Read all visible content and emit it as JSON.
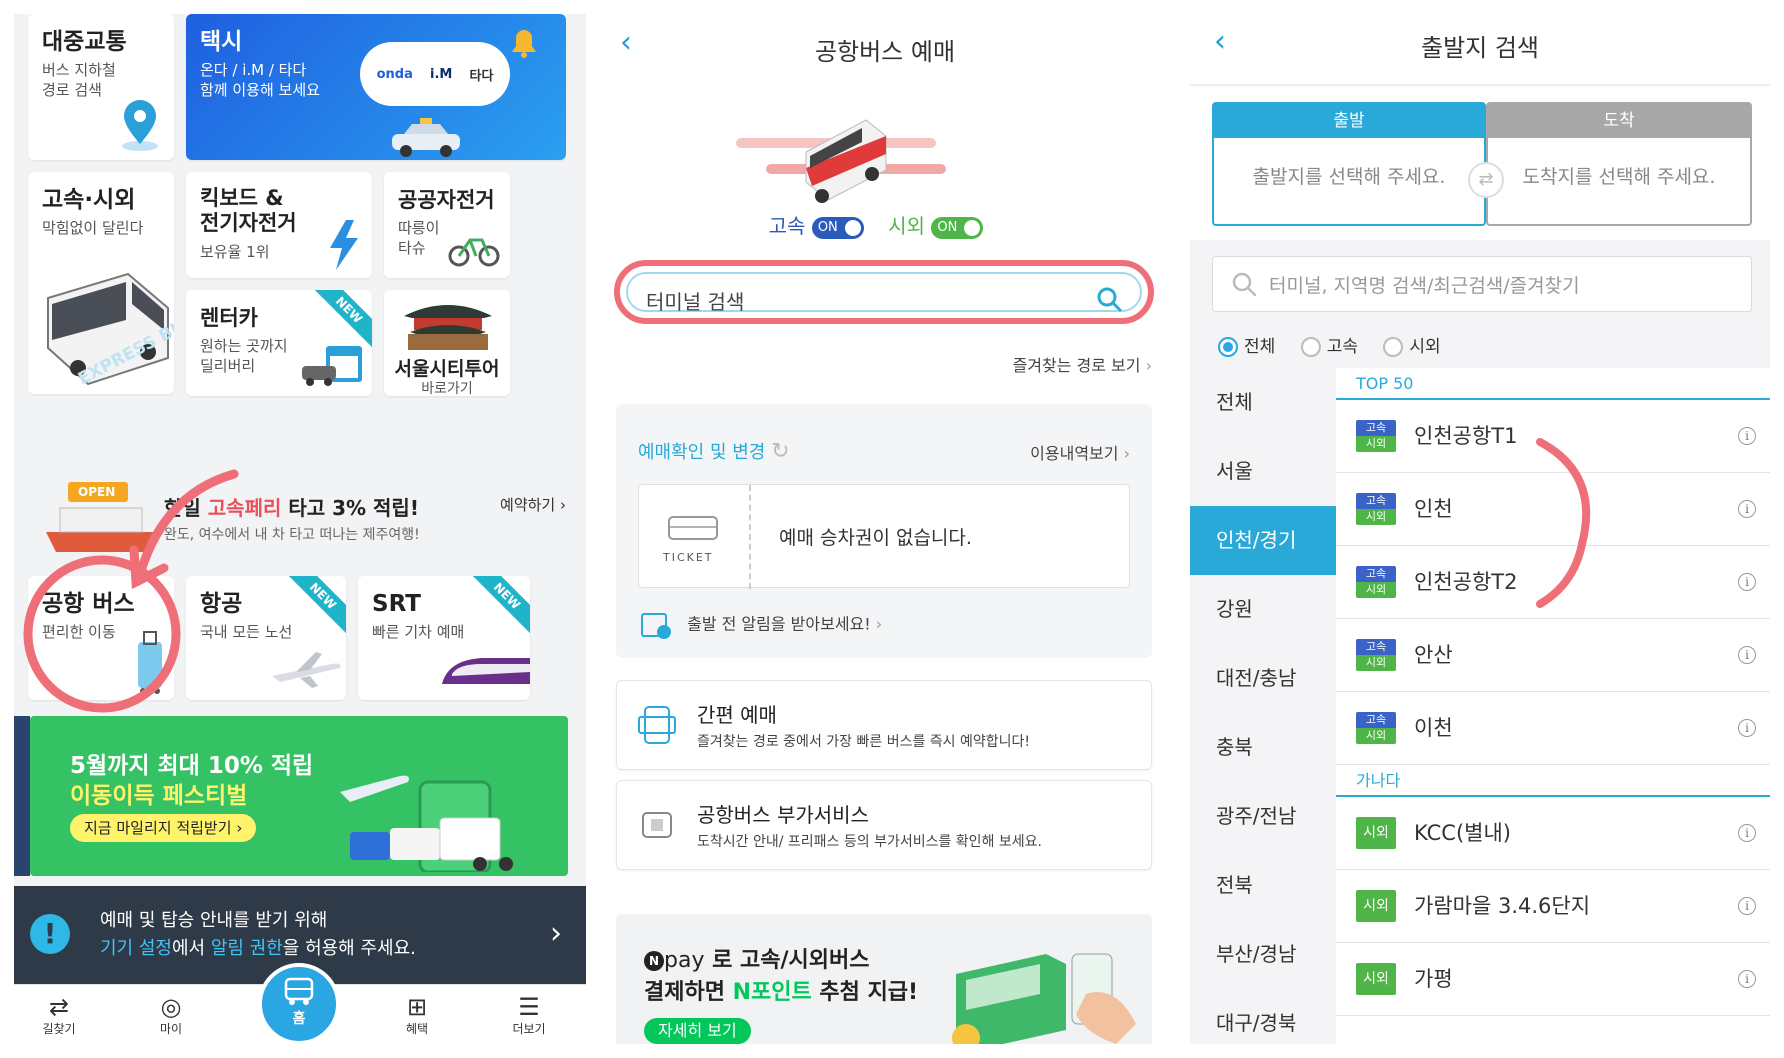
{
  "screen1": {
    "transit": {
      "title": "대중교통",
      "sub": "버스 지하철\n경로 검색"
    },
    "taxi": {
      "title": "택시",
      "sub": "온다 / i.M / 타다\n함께 이용해 보세요",
      "brands": [
        "onda",
        "i.M",
        "타다"
      ]
    },
    "express": {
      "title": "고속·시외",
      "sub": "막힘없이 달린다",
      "bus_text": "EXPRESS BUS"
    },
    "kick": {
      "title": "킥보드 &\n전기자전거",
      "sub": "보유율 1위"
    },
    "bike": {
      "title": "공공자전거",
      "sub": "따릉이\n타슈"
    },
    "rent": {
      "title": "렌터카",
      "sub": "원하는 곳까지\n딜리버리",
      "badge": "NEW"
    },
    "citytour": {
      "title": "서울시티투어",
      "sub": "바로가기"
    },
    "ferry": {
      "open": "OPEN",
      "pre": "한일 ",
      "highlight": "고속페리",
      "post": " 타고 3% 적립!",
      "sub": "완도, 여수에서 내 차 타고 떠나는 제주여행!",
      "action": "예약하기"
    },
    "airport": {
      "title": "공항 버스",
      "sub": "편리한 이동"
    },
    "air": {
      "title": "항공",
      "sub": "국내 모든 노선",
      "badge": "NEW"
    },
    "srt": {
      "title": "SRT",
      "sub": "빠른 기차 예매",
      "badge": "NEW"
    },
    "promo": {
      "line1": "5월까지 최대 10% 적립",
      "line2": "이동이득 페스티벌",
      "cta": "지금 마일리지 적립받기"
    },
    "notice": {
      "line1": "예매 및 탑승 안내를 받기 위해",
      "link1": "기기 설정",
      "mid": "에서 ",
      "link2": "알림 권한",
      "end": "을 허용해 주세요."
    },
    "tabs": [
      {
        "label": "길찾기",
        "icon": "route-icon"
      },
      {
        "label": "마이",
        "icon": "user-icon"
      },
      {
        "label": "홈",
        "icon": "bus-icon"
      },
      {
        "label": "혜택",
        "icon": "gift-icon"
      },
      {
        "label": "더보기",
        "icon": "menu-icon"
      }
    ]
  },
  "screen2": {
    "title": "공항버스 예매",
    "toggle1_label": "고속",
    "toggle1_state": "ON",
    "toggle2_label": "시외",
    "toggle2_state": "ON",
    "search_placeholder": "터미널 검색",
    "fav_route": "즐겨찾는 경로 보기",
    "reservation": {
      "title": "예매확인 및 변경",
      "history": "이용내역보기",
      "ticket_label": "TICKET",
      "empty": "예매 승차권이 없습니다.",
      "alarm": "출발 전 알림을 받아보세요!"
    },
    "quick": {
      "title": "간편 예매",
      "desc": "즐겨찾는 경로 중에서 가장 빠른 버스를 즉시 예약합니다!"
    },
    "extra": {
      "title": "공항버스 부가서비스",
      "desc": "도착시간 안내/ 프리패스 등의 부가서비스를 확인해 보세요."
    },
    "npay": {
      "brand": "pay",
      "line1": " 로 고속/시외버스",
      "line2_pre": "결제하면 ",
      "line2_hl": "N포인트",
      "line2_post": " 추첨 지급!",
      "cta": "자세히 보기"
    }
  },
  "screen3": {
    "title": "출발지 검색",
    "depart": {
      "label": "출발",
      "placeholder": "출발지를 선택해 주세요."
    },
    "arrive": {
      "label": "도착",
      "placeholder": "도착지를 선택해 주세요."
    },
    "search_placeholder": "터미널, 지역명 검색/최근검색/즐겨찾기",
    "filters": [
      "전체",
      "고속",
      "시외"
    ],
    "regions": [
      "전체",
      "서울",
      "인천/경기",
      "강원",
      "대전/충남",
      "충북",
      "광주/전남",
      "전북",
      "부산/경남",
      "대구/경북"
    ],
    "active_region": 2,
    "top_header": "TOP 50",
    "top_items": [
      "인천공항T1",
      "인천",
      "인천공항T2",
      "안산",
      "이천"
    ],
    "tag_top": "고속",
    "tag_bottom": "시외",
    "gana_header": "가나다",
    "gana_items": [
      "KCC(별내)",
      "가람마을 3.4.6단지",
      "가평"
    ],
    "gana_tag": "시외",
    "colors": {
      "accent": "#29a9d8",
      "depart": "#29a9d8",
      "arrive": "#a8a8a8",
      "express": "#3b62c6",
      "intercity": "#4fb548",
      "highlight": "#ef6f78"
    }
  }
}
